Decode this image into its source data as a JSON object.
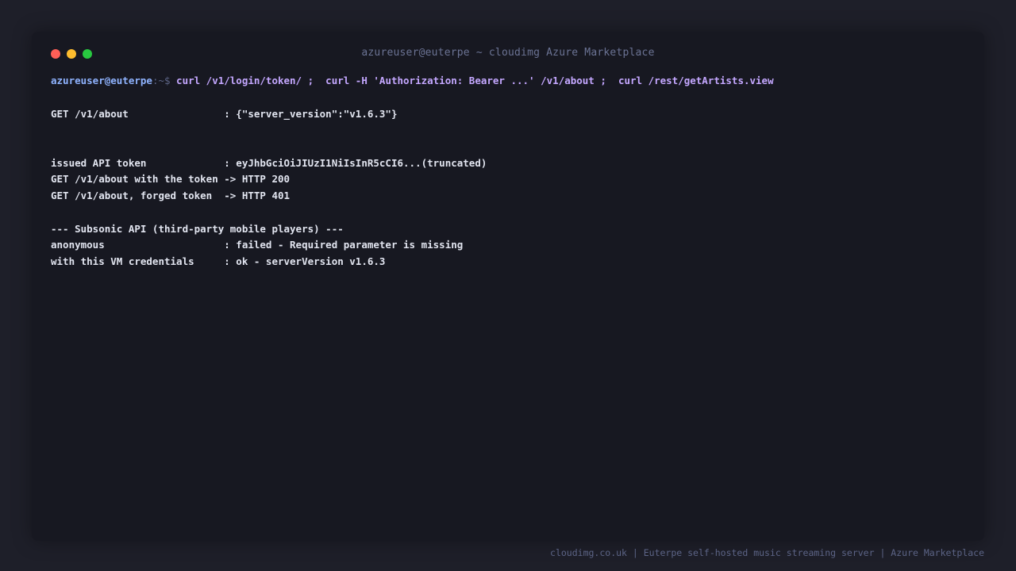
{
  "window": {
    "title": "azureuser@euterpe ~ cloudimg Azure Marketplace",
    "traffic_lights": [
      "close",
      "minimize",
      "maximize"
    ],
    "colors": {
      "close": "#ff5f57",
      "minimize": "#febc2e",
      "maximize": "#28c840"
    }
  },
  "prompt": {
    "user": "azureuser@euterpe",
    "path": ":~$",
    "command": " curl /v1/login/token/ ;  curl -H 'Authorization: Bearer ...' /v1/about ;  curl /rest/getArtists.view"
  },
  "output": {
    "about": "GET /v1/about                : {\"server_version\":\"v1.6.3\"}",
    "token_issued": "issued API token             : eyJhbGciOiJIUzI1NiIsInR5cCI6...(truncated)",
    "about_with_token": "GET /v1/about with the token -> HTTP 200",
    "about_forged": "GET /v1/about, forged token  -> HTTP 401",
    "subsonic_header": "--- Subsonic API (third-party mobile players) ---",
    "anonymous": "anonymous                    : failed - Required parameter is missing",
    "with_credentials": "with this VM credentials     : ok - serverVersion v1.6.3"
  },
  "footer": "cloudimg.co.uk | Euterpe self-hosted music streaming server | Azure Marketplace"
}
